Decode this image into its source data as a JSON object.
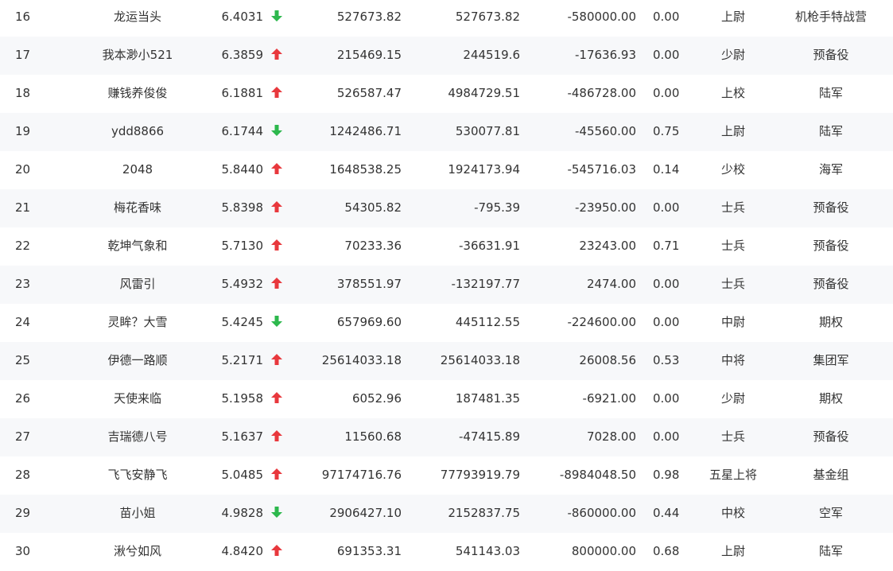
{
  "colors": {
    "up": "#e8383d",
    "down": "#2db84d",
    "alt_row": "#f7f8fa"
  },
  "rows": [
    {
      "rank": "16",
      "name": "龙运当头",
      "score": "6.4031",
      "trend": "down",
      "v1": "527673.82",
      "v2": "527673.82",
      "v3": "-580000.00",
      "ratio": "0.00",
      "title": "上尉",
      "group": "机枪手特战营"
    },
    {
      "rank": "17",
      "name": "我本渺小521",
      "score": "6.3859",
      "trend": "up",
      "v1": "215469.15",
      "v2": "244519.6",
      "v3": "-17636.93",
      "ratio": "0.00",
      "title": "少尉",
      "group": "预备役"
    },
    {
      "rank": "18",
      "name": "赚钱养俊俊",
      "score": "6.1881",
      "trend": "up",
      "v1": "526587.47",
      "v2": "4984729.51",
      "v3": "-486728.00",
      "ratio": "0.00",
      "title": "上校",
      "group": "陆军"
    },
    {
      "rank": "19",
      "name": "ydd8866",
      "score": "6.1744",
      "trend": "down",
      "v1": "1242486.71",
      "v2": "530077.81",
      "v3": "-45560.00",
      "ratio": "0.75",
      "title": "上尉",
      "group": "陆军"
    },
    {
      "rank": "20",
      "name": "2048",
      "score": "5.8440",
      "trend": "up",
      "v1": "1648538.25",
      "v2": "1924173.94",
      "v3": "-545716.03",
      "ratio": "0.14",
      "title": "少校",
      "group": "海军"
    },
    {
      "rank": "21",
      "name": "梅花香味",
      "score": "5.8398",
      "trend": "up",
      "v1": "54305.82",
      "v2": "-795.39",
      "v3": "-23950.00",
      "ratio": "0.00",
      "title": "士兵",
      "group": "预备役"
    },
    {
      "rank": "22",
      "name": "乾坤气象和",
      "score": "5.7130",
      "trend": "up",
      "v1": "70233.36",
      "v2": "-36631.91",
      "v3": "23243.00",
      "ratio": "0.71",
      "title": "士兵",
      "group": "预备役"
    },
    {
      "rank": "23",
      "name": "风雷引",
      "score": "5.4932",
      "trend": "up",
      "v1": "378551.97",
      "v2": "-132197.77",
      "v3": "2474.00",
      "ratio": "0.00",
      "title": "士兵",
      "group": "预备役"
    },
    {
      "rank": "24",
      "name": "灵眸？大雪",
      "score": "5.4245",
      "trend": "down",
      "v1": "657969.60",
      "v2": "445112.55",
      "v3": "-224600.00",
      "ratio": "0.00",
      "title": "中尉",
      "group": "期权"
    },
    {
      "rank": "25",
      "name": "伊德一路顺",
      "score": "5.2171",
      "trend": "up",
      "v1": "25614033.18",
      "v2": "25614033.18",
      "v3": "26008.56",
      "ratio": "0.53",
      "title": "中将",
      "group": "集团军"
    },
    {
      "rank": "26",
      "name": "天使来临",
      "score": "5.1958",
      "trend": "up",
      "v1": "6052.96",
      "v2": "187481.35",
      "v3": "-6921.00",
      "ratio": "0.00",
      "title": "少尉",
      "group": "期权"
    },
    {
      "rank": "27",
      "name": "吉瑞德八号",
      "score": "5.1637",
      "trend": "up",
      "v1": "11560.68",
      "v2": "-47415.89",
      "v3": "7028.00",
      "ratio": "0.00",
      "title": "士兵",
      "group": "预备役"
    },
    {
      "rank": "28",
      "name": "飞飞安静飞",
      "score": "5.0485",
      "trend": "up",
      "v1": "97174716.76",
      "v2": "77793919.79",
      "v3": "-8984048.50",
      "ratio": "0.98",
      "title": "五星上将",
      "group": "基金组"
    },
    {
      "rank": "29",
      "name": "苗小姐",
      "score": "4.9828",
      "trend": "down",
      "v1": "2906427.10",
      "v2": "2152837.75",
      "v3": "-860000.00",
      "ratio": "0.44",
      "title": "中校",
      "group": "空军"
    },
    {
      "rank": "30",
      "name": "湫兮如风",
      "score": "4.8420",
      "trend": "up",
      "v1": "691353.31",
      "v2": "541143.03",
      "v3": "800000.00",
      "ratio": "0.68",
      "title": "上尉",
      "group": "陆军"
    }
  ]
}
